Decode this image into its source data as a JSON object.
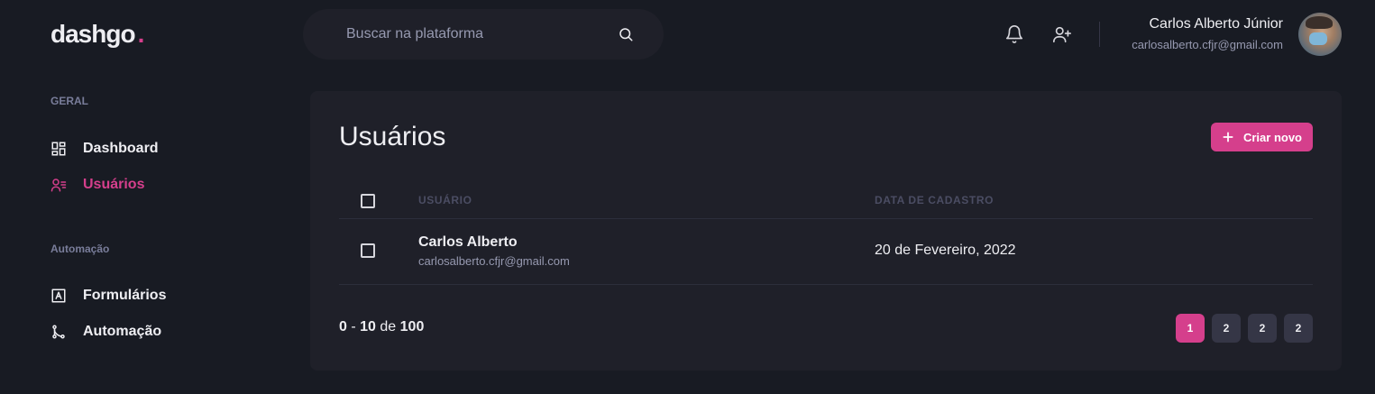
{
  "header": {
    "logo_text": "dashgo",
    "logo_dot": ".",
    "search_placeholder": "Buscar na plataforma",
    "profile_name": "Carlos Alberto Júnior",
    "profile_email": "carlosalberto.cfjr@gmail.com"
  },
  "sidebar": {
    "sections": [
      {
        "title": "GERAL",
        "items": [
          {
            "label": "Dashboard",
            "icon": "dashboard-icon",
            "active": false
          },
          {
            "label": "Usuários",
            "icon": "users-icon",
            "active": true
          }
        ]
      },
      {
        "title": "Automação",
        "items": [
          {
            "label": "Formulários",
            "icon": "form-icon",
            "active": false
          },
          {
            "label": "Automação",
            "icon": "git-branch-icon",
            "active": false
          }
        ]
      }
    ]
  },
  "main": {
    "title": "Usuários",
    "create_button_label": "Criar novo",
    "columns": [
      "USUÁRIO",
      "DATA DE CADASTRO"
    ],
    "rows": [
      {
        "name": "Carlos Alberto",
        "email": "carlosalberto.cfjr@gmail.com",
        "date": "20 de Fevereiro, 2022"
      }
    ],
    "pagination": {
      "range_start": "0",
      "range_sep": "-",
      "range_end": "10",
      "of_label": "de",
      "total": "100",
      "pages": [
        "1",
        "2",
        "2",
        "2"
      ],
      "current_page": "1"
    }
  },
  "colors": {
    "background": "#181b23",
    "surface": "#1f2029",
    "accent": "#d53f8c",
    "muted": "#9699b0"
  }
}
